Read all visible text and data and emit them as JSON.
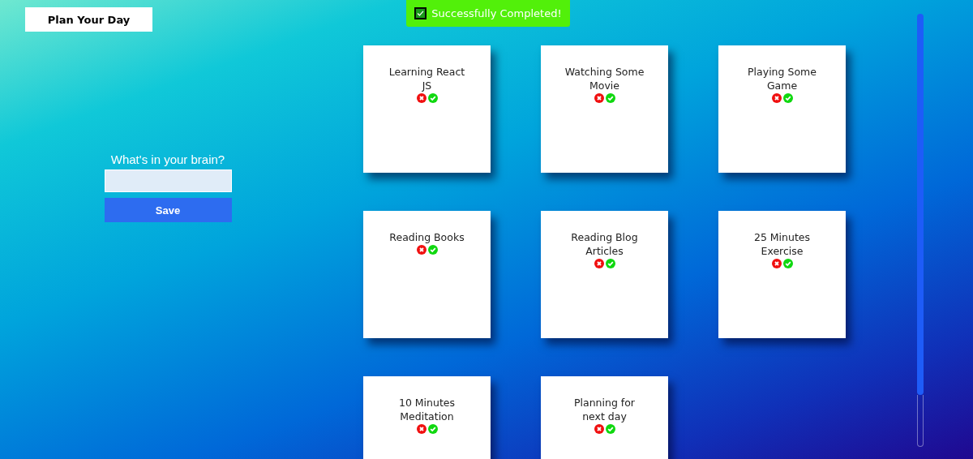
{
  "header_button": {
    "label": "Plan Your Day"
  },
  "toast": {
    "message": "Successfully Completed!",
    "checked": true
  },
  "form": {
    "label": "What's in your brain?",
    "button": "Save"
  },
  "tasks": [
    {
      "title": "Learning React JS"
    },
    {
      "title": "Watching Some Movie"
    },
    {
      "title": "Playing Some Game"
    },
    {
      "title": "Reading Books"
    },
    {
      "title": "Reading Blog Articles"
    },
    {
      "title": "25 Minutes Exercise"
    },
    {
      "title": "10 Minutes Meditation"
    },
    {
      "title": "Planning for next day"
    }
  ]
}
